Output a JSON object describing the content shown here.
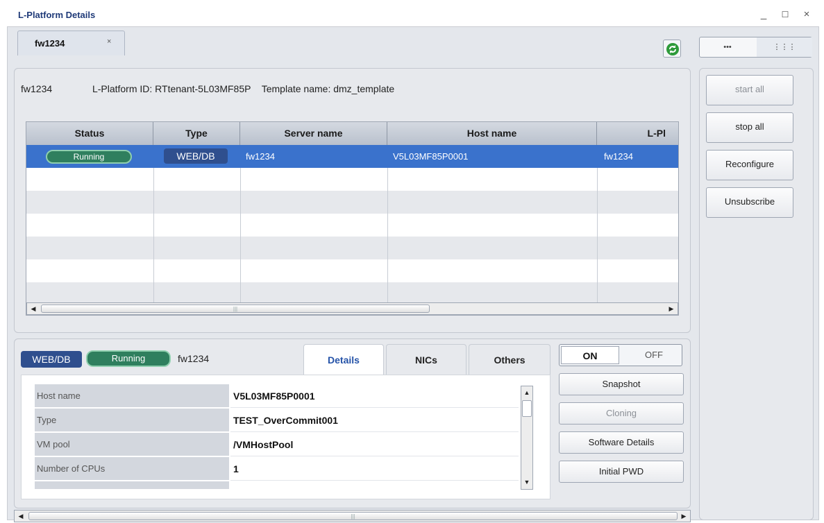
{
  "window": {
    "title": "L-Platform Details",
    "minimize": "_",
    "maximize": "☐",
    "close": "×"
  },
  "tab": {
    "label": "fw1234",
    "close": "×"
  },
  "view_toggle": {
    "left": "•••",
    "right": "⋮⋮⋮"
  },
  "info": {
    "name": "fw1234",
    "platform_id_text": "L-Platform ID: RTtenant-5L03MF85P",
    "template_text": "Template name: dmz_template"
  },
  "table": {
    "columns": [
      "Status",
      "Type",
      "Server name",
      "Host name",
      "L-Pl"
    ],
    "rows": [
      {
        "status": "Running",
        "type": "WEB/DB",
        "server_name": "fw1234",
        "host_name": "V5L03MF85P0001",
        "lpl": "fw1234"
      }
    ],
    "scroll_grip": "|||"
  },
  "side_buttons": {
    "start_all": "start all",
    "stop_all": "stop all",
    "reconfigure": "Reconfigure",
    "unsubscribe": "Unsubscribe"
  },
  "detail": {
    "type_badge": "WEB/DB",
    "status_badge": "Running",
    "server": "fw1234",
    "tabs": [
      "Details",
      "NICs",
      "Others"
    ],
    "properties": [
      {
        "label": "Host name",
        "value": "V5L03MF85P0001"
      },
      {
        "label": "Type",
        "value": "TEST_OverCommit001"
      },
      {
        "label": "VM pool",
        "value": "/VMHostPool"
      },
      {
        "label": "Number of CPUs",
        "value": "1"
      }
    ]
  },
  "power": {
    "on": "ON",
    "off": "OFF"
  },
  "detail_buttons": {
    "snapshot": "Snapshot",
    "cloning": "Cloning",
    "software_details": "Software Details",
    "initial_pwd": "Initial PWD"
  },
  "colors": {
    "selection": "#3a72cc",
    "running": "#2f7f5e",
    "type_badge": "#2f4f8e",
    "title": "#1f3a78"
  }
}
